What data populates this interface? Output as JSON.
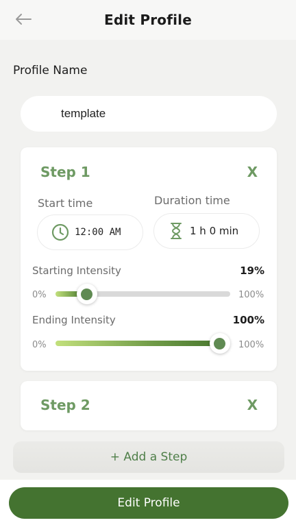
{
  "header": {
    "title": "Edit Profile",
    "back_icon": "arrow-left-icon"
  },
  "profile": {
    "label": "Profile Name",
    "name_value": "template"
  },
  "steps": [
    {
      "title": "Step 1",
      "close_label": "X",
      "start_time": {
        "label": "Start time",
        "value": "12:00 AM",
        "icon": "clock-icon"
      },
      "duration": {
        "label": "Duration time",
        "value": "1 h 0 min",
        "icon": "hourglass-icon"
      },
      "starting_intensity": {
        "label": "Starting Intensity",
        "value_label": "19%",
        "value": 19,
        "min_label": "0%",
        "max_label": "100%"
      },
      "ending_intensity": {
        "label": "Ending Intensity",
        "value_label": "100%",
        "value": 100,
        "min_label": "0%",
        "max_label": "100%"
      }
    },
    {
      "title": "Step 2",
      "close_label": "X"
    }
  ],
  "add_step_label": "+ Add a Step",
  "submit_label": "Edit Profile",
  "colors": {
    "accent": "#6e9a63",
    "primary_button": "#447330",
    "slider_thumb": "#5f8a52",
    "background": "#f2f2f0"
  }
}
